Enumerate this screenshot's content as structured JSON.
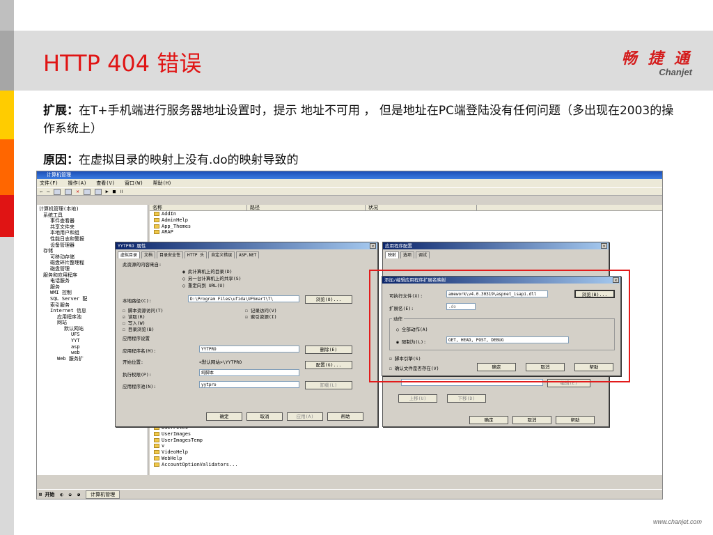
{
  "slide": {
    "title": "HTTP 404 错误",
    "logo_cn": "畅 捷 通",
    "logo_en": "Chanjet",
    "footer_url": "www.chanjet.com",
    "colors": {
      "title": "#e01414",
      "band": "#dcdcdc",
      "highlight": "#e21b1b"
    },
    "expansion_label": "扩展：",
    "expansion_text": "在T+手机端进行服务器地址设置时，提示 地址不可用 ， 但是地址在PC端登陆没有任何问题（多出现在2003的操作系统上）",
    "cause_label": "原因：",
    "cause_text": "在虚拟目录的映射上没有.do的映射导致的"
  },
  "screenshot": {
    "window_title": "计算机管理",
    "menu": [
      "文件(F)",
      "操作(A)",
      "查看(V)",
      "窗口(W)",
      "帮助(H)"
    ],
    "tree": [
      "计算机管理(本地)",
      "系统工具",
      "事件查看器",
      "共享文件夹",
      "本地用户和组",
      "性能日志和警报",
      "设备管理器",
      "存储",
      "可移动存储",
      "磁盘碎片整理程",
      "磁盘管理",
      "服务和应用程序",
      "电话服务",
      "服务",
      "WMI 控制",
      "SQL Server 配",
      "索引服务",
      "Internet 信息",
      "应用程序池",
      "网站",
      "默认网站",
      "UFS",
      "YYT",
      "asp",
      "web",
      "Web 服务扩"
    ],
    "list_columns": [
      "名称",
      "路径",
      "状况"
    ],
    "list_items_top": [
      "AddIn",
      "AdminHelp",
      "App_Themes",
      "ARAP"
    ],
    "list_items_bottom": [
      "UserFiles",
      "UserImages",
      "UserImagesTemp",
      "v",
      "VideoHelp",
      "WebHelp",
      "AccountOptionValidators..."
    ],
    "props_dialog": {
      "title": "YYTPRO 属性",
      "tabs": [
        "虚拟目录",
        "文档",
        "目录安全性",
        "HTTP 头",
        "自定义错误",
        "ASP.NET"
      ],
      "source_label": "此资源的内容来自:",
      "radio1": "此计算机上的目录(D)",
      "radio2": "另一台计算机上的共享(S)",
      "radio3": "重定向到 URL(U)",
      "local_path_label": "本地路径(C):",
      "local_path_value": "D:\\Program Files\\ufida\\UFSmart\\T\\",
      "browse": "浏览(O)...",
      "cb_script": "脚本资源访问(T)",
      "cb_read": "读取(R)",
      "cb_write": "写入(W)",
      "cb_browse": "目录浏览(B)",
      "cb_log": "记录访问(V)",
      "cb_index": "索引资源(I)",
      "app_settings": "应用程序设置",
      "app_name_label": "应用程序名(M):",
      "app_name_value": "YYTPRO",
      "start_label": "开始位置:",
      "start_value": "<默认网站>\\YYTPRO",
      "exec_label": "执行权限(P):",
      "exec_value": "纯脚本",
      "pool_label": "应用程序池(N):",
      "pool_value": "yytpro",
      "remove": "删除(E)",
      "config": "配置(G)...",
      "unload": "卸载(L)",
      "ok": "确定",
      "cancel": "取消",
      "apply": "应用(A)",
      "help": "帮助"
    },
    "app_config_dialog": {
      "title": "应用程序配置",
      "tabs": [
        "映射",
        "选项",
        "调试"
      ],
      "move_up": "上移(U)",
      "move_down": "下移(D)",
      "edit": "编辑(E)",
      "ok": "确定",
      "cancel": "取消",
      "help": "帮助"
    },
    "mapping_dialog": {
      "title": "添加/编辑应用程序扩展名映射",
      "exe_label": "可执行文件(X):",
      "exe_value": "amework\\v4.0.30319\\aspnet_isapi.dll",
      "browse": "浏览(B)...",
      "ext_label": "扩展名(E):",
      "ext_value": ".do",
      "verbs_label": "动作",
      "all_verbs": "全部动作(A)",
      "limit_to": "限制为(L):",
      "limit_value": "GET, HEAD, POST, DEBUG",
      "script_engine": "脚本引擎(S)",
      "verify_file": "确认文件是否存在(V)",
      "ok": "确定",
      "cancel": "取消",
      "help": "帮助"
    },
    "taskbar": {
      "start": "开始",
      "task": "计算机管理"
    }
  }
}
